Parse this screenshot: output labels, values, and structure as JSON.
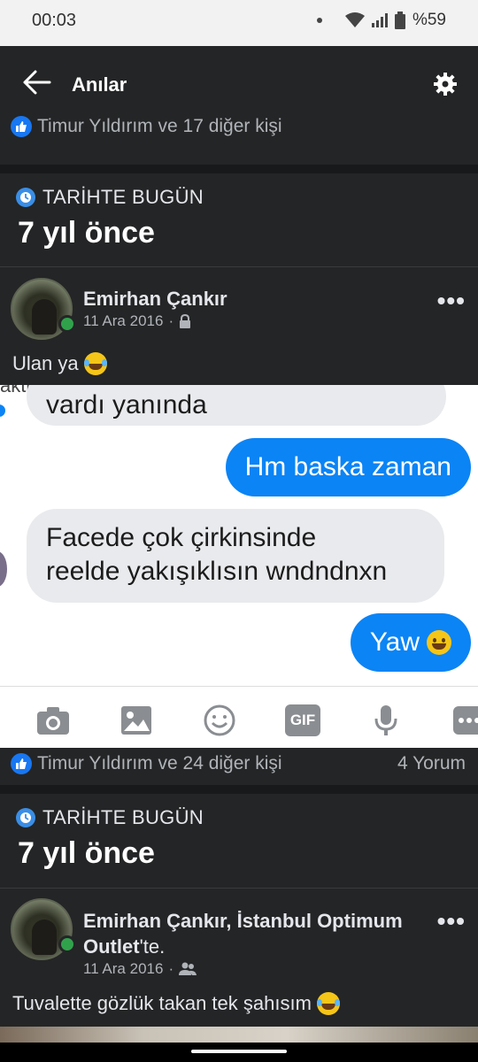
{
  "status_bar": {
    "time": "00:03",
    "battery": "%59"
  },
  "app_bar": {
    "title": "Anılar"
  },
  "top_likes": {
    "text": "Timur Yıldırım ve 17 diğer kişi"
  },
  "memory1": {
    "section_label": "TARİHTE BUGÜN",
    "years": "7 yıl önce",
    "author": "Emirhan Çankır",
    "date": "11 Ara 2016",
    "privacy_icon": "lock-icon",
    "text": "Ulan ya"
  },
  "screenshot": {
    "cut_text": "aktii",
    "partial_bubble": "vardı yanında",
    "messages": [
      {
        "side": "out",
        "text": "Hm baska zaman"
      },
      {
        "side": "in",
        "line1": "Facede çok çirkinsinde",
        "line2": "reelde yakışıklısın wndndnxn"
      },
      {
        "side": "out",
        "text": "Yaw"
      }
    ],
    "toolbar_icons": [
      "camera-icon",
      "image-icon",
      "emoji-icon",
      "gif-icon",
      "mic-icon",
      "more-icon"
    ],
    "gif_label": "GIF"
  },
  "memory1_footer": {
    "likes": "Timur Yıldırım ve 24 diğer kişi",
    "comments": "4 Yorum"
  },
  "memory2": {
    "section_label": "TARİHTE BUGÜN",
    "years": "7 yıl önce",
    "author": "Emirhan Çankır",
    "author_sep": ", ",
    "place": "İstanbul Optimum Outlet",
    "suffix": "'te.",
    "date": "11 Ara 2016",
    "privacy_icon": "friends-icon",
    "text": "Tuvalette gözlük takan tek şahısım"
  },
  "colors": {
    "accent": "#1877f2",
    "messenger_blue": "#0b84f5",
    "online": "#31a24c"
  }
}
